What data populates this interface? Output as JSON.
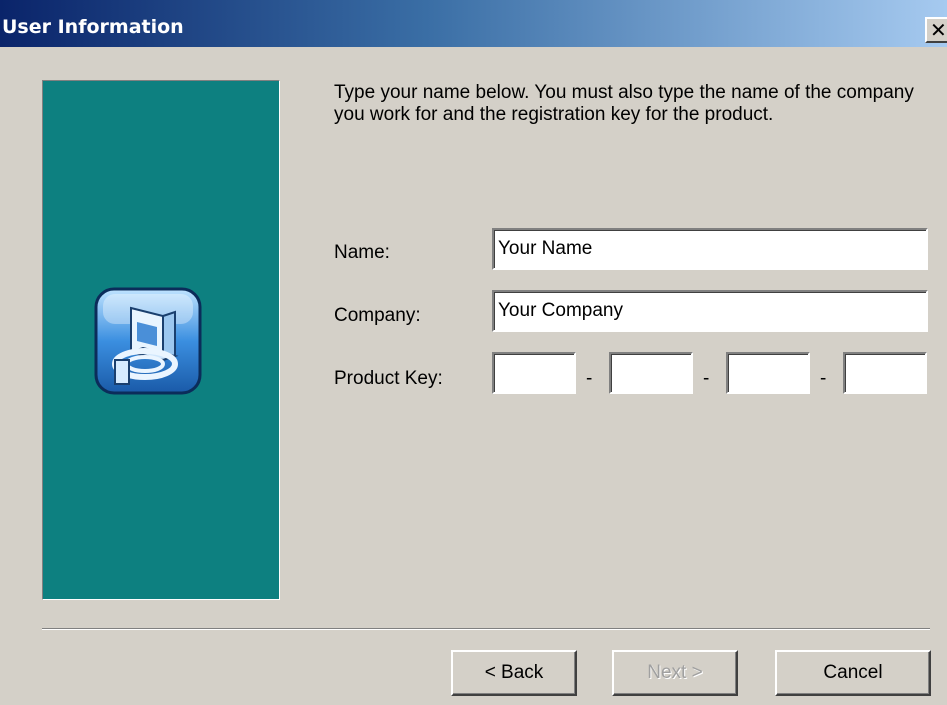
{
  "window": {
    "title": "User Information",
    "close_glyph": "✕"
  },
  "side_panel": {
    "color": "#0d8080",
    "icon": "setup-computer-icon"
  },
  "instructions": "Type your name below.  You must also type the name of the company you work for and the registration key for the product.",
  "form": {
    "name_label": "Name:",
    "name_value": "Your Name",
    "company_label": "Company:",
    "company_value": "Your Company",
    "product_key_label": "Product Key:",
    "product_key_segments": [
      "",
      "",
      "",
      ""
    ],
    "separator": "-"
  },
  "buttons": {
    "back_label": "< Back",
    "next_label": "Next >",
    "next_enabled": false,
    "cancel_label": "Cancel"
  },
  "colors": {
    "titlebar_start": "#0a246a",
    "titlebar_end": "#a6caf0",
    "dialog_bg": "#d4d0c8"
  }
}
